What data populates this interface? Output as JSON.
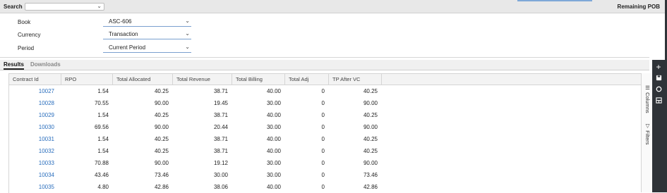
{
  "search": {
    "label": "Search",
    "value": ""
  },
  "page_title": "Remaining POB",
  "filters": [
    {
      "label": "Book",
      "value": "ASC-606"
    },
    {
      "label": "Currency",
      "value": "Transaction"
    },
    {
      "label": "Period",
      "value": "Current Period"
    }
  ],
  "tabs": {
    "results": "Results",
    "downloads": "Downloads"
  },
  "table": {
    "headers": [
      "Contract Id",
      "RPO",
      "Total Allocated",
      "Total Revenue",
      "Total Billing",
      "Total Adj",
      "TP After VC"
    ],
    "rows": [
      [
        "10027",
        "1.54",
        "40.25",
        "38.71",
        "40.00",
        "0",
        "40.25"
      ],
      [
        "10028",
        "70.55",
        "90.00",
        "19.45",
        "30.00",
        "0",
        "90.00"
      ],
      [
        "10029",
        "1.54",
        "40.25",
        "38.71",
        "40.00",
        "0",
        "40.25"
      ],
      [
        "10030",
        "69.56",
        "90.00",
        "20.44",
        "30.00",
        "0",
        "90.00"
      ],
      [
        "10031",
        "1.54",
        "40.25",
        "38.71",
        "40.00",
        "0",
        "40.25"
      ],
      [
        "10032",
        "1.54",
        "40.25",
        "38.71",
        "40.00",
        "0",
        "40.25"
      ],
      [
        "10033",
        "70.88",
        "90.00",
        "19.12",
        "30.00",
        "0",
        "90.00"
      ],
      [
        "10034",
        "43.46",
        "73.46",
        "30.00",
        "30.00",
        "0",
        "73.46"
      ],
      [
        "10035",
        "4.80",
        "42.86",
        "38.06",
        "40.00",
        "0",
        "42.86"
      ]
    ]
  },
  "side_tabs": {
    "columns": "Columns",
    "filters": "Filters"
  },
  "icons": {
    "add": "plus-icon",
    "save": "save-icon",
    "refresh": "circle-icon",
    "layout": "table-icon",
    "columns": "columns-icon",
    "filters": "filter-icon"
  },
  "colors": {
    "link": "#2a6ebd",
    "toolbar": "#2f3338",
    "accent": "#7aa0cf"
  }
}
